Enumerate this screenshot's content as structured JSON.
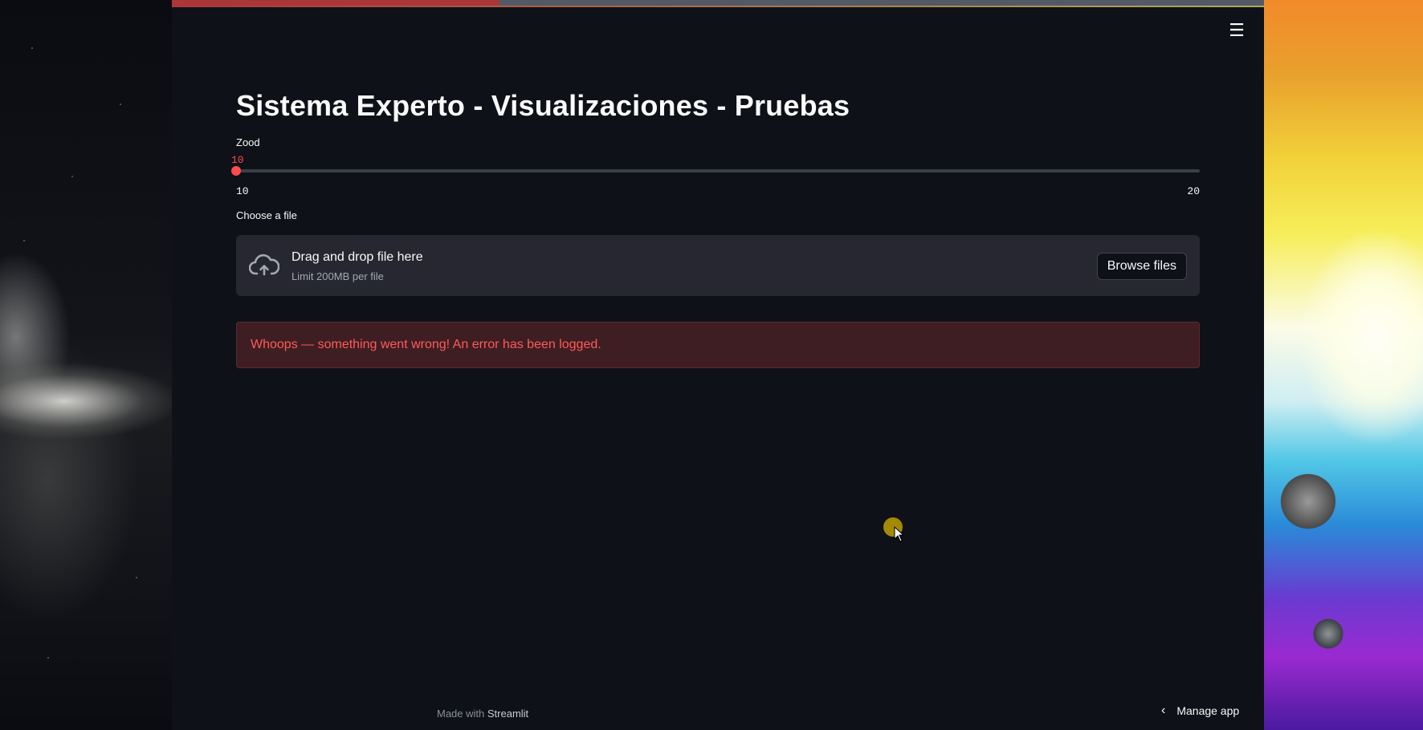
{
  "header": {
    "menu_icon": "hamburger-menu-icon",
    "menu_glyph": "☰"
  },
  "main": {
    "title": "Sistema Experto - Visualizaciones - Pruebas",
    "slider": {
      "label": "Zood",
      "current_value": "10",
      "min": "10",
      "max": "20",
      "position_fraction": 0.0,
      "accent_color": "#ff4b4b"
    },
    "uploader": {
      "label": "Choose a file",
      "drop_text": "Drag and drop file here",
      "limit_text": "Limit 200MB per file",
      "browse_label": "Browse files",
      "icon": "cloud-upload-icon"
    },
    "error": {
      "message": "Whoops — something went wrong! An error has been logged.",
      "color": "#ff5a5a"
    }
  },
  "footer": {
    "made_with": "Made with",
    "brand": "Streamlit",
    "manage_app": "Manage app",
    "manage_icon": "chevron-left-icon"
  },
  "theme": {
    "background": "#0e1117",
    "secondary_background": "#262730",
    "text": "#fafafa",
    "primary": "#ff4b4b"
  }
}
